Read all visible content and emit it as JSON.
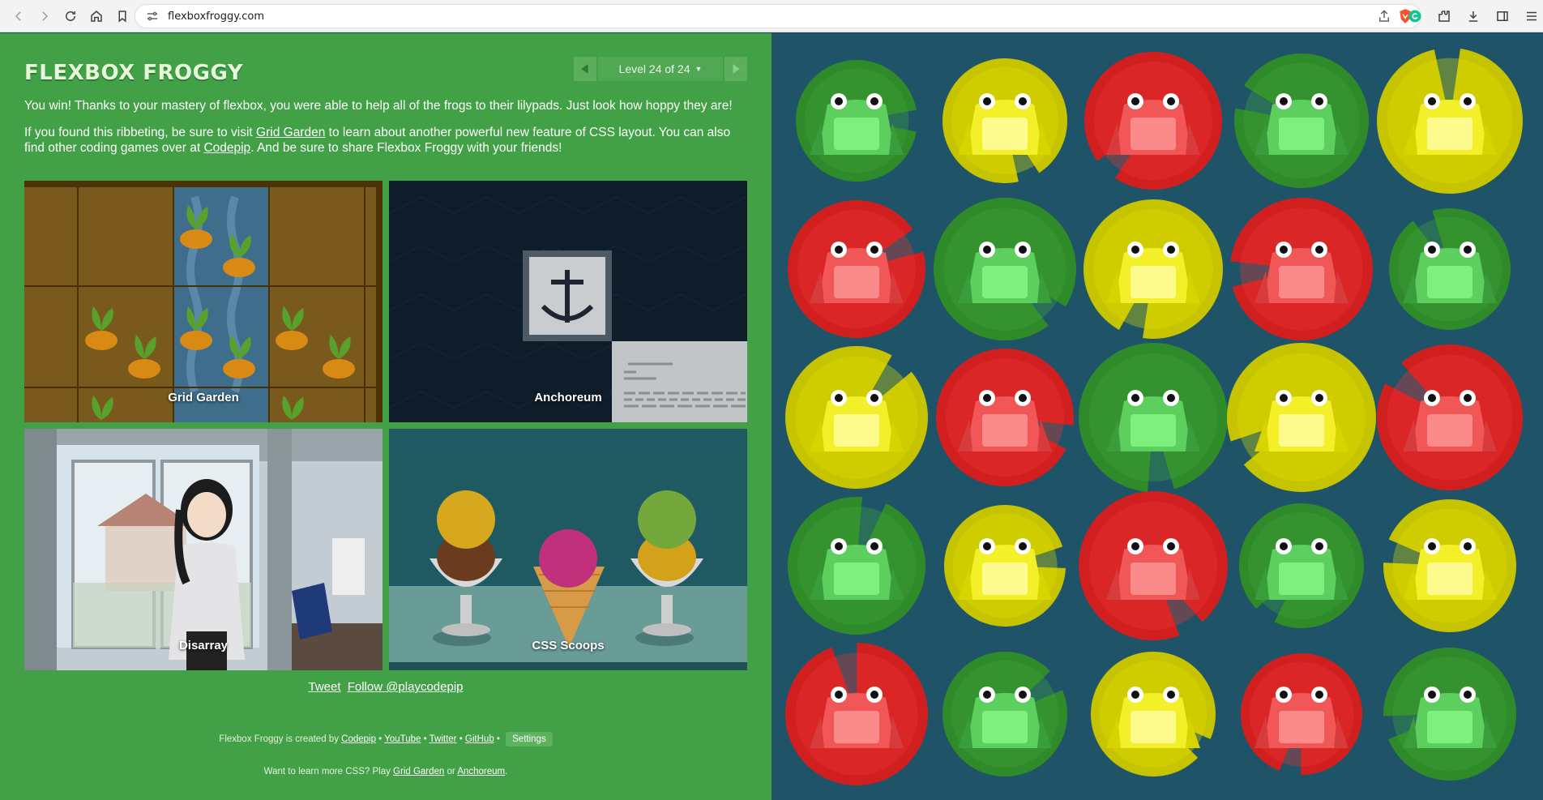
{
  "browser": {
    "url": "flexboxfroggy.com"
  },
  "header": {
    "logo": "FLEXBOX FROGGY",
    "level_label": "Level 24 of 24"
  },
  "instructions": {
    "p1": "You win! Thanks to your mastery of flexbox, you were able to help all of the frogs to their lilypads. Just look how hoppy they are!",
    "p2_pre": "If you found this ribbeting, be sure to visit ",
    "p2_link1": "Grid Garden",
    "p2_mid": " to learn about another powerful new feature of CSS layout. You can also find other coding games over at ",
    "p2_link2": "Codepip",
    "p2_post": ". And be sure to share Flexbox Froggy with your friends!"
  },
  "games": [
    {
      "title": "Grid Garden"
    },
    {
      "title": "Anchoreum"
    },
    {
      "title": "Disarray"
    },
    {
      "title": "CSS Scoops"
    }
  ],
  "share": {
    "tweet": "Tweet",
    "follow": "Follow @playcodepip"
  },
  "footer": {
    "credit_pre": "Flexbox Froggy is created by ",
    "codepip": "Codepip",
    "sep": " • ",
    "youtube": "YouTube",
    "twitter": "Twitter",
    "github": "GitHub",
    "settings": "Settings",
    "learn_pre": "Want to learn more CSS? Play ",
    "learn_link1": "Grid Garden",
    "learn_or": " or ",
    "learn_link2": "Anchoreum",
    "learn_post": "."
  },
  "colors": {
    "background_left": "#42a046",
    "pond": "#1f5468",
    "green_pad": "#2f8a2a",
    "yellow_pad": "#c9c900",
    "red_pad": "#d11f1f"
  },
  "pond_grid": [
    [
      "green",
      "yellow",
      "red",
      "green",
      "yellow"
    ],
    [
      "red",
      "green",
      "yellow",
      "red",
      "green"
    ],
    [
      "yellow",
      "red",
      "green",
      "yellow",
      "red"
    ],
    [
      "green",
      "yellow",
      "red",
      "green",
      "yellow"
    ],
    [
      "red",
      "green",
      "yellow",
      "red",
      "green"
    ]
  ]
}
